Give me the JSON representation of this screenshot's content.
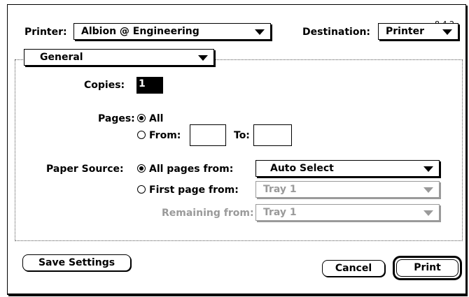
{
  "version": "8.4.2",
  "printer": {
    "label": "Printer:",
    "value": "Albion @ Engineering"
  },
  "destination": {
    "label": "Destination:",
    "value": "Printer"
  },
  "section": {
    "value": "General"
  },
  "copies": {
    "label": "Copies:",
    "value": "1"
  },
  "pages": {
    "label": "Pages:",
    "all_label": "All",
    "from_label": "From:",
    "to_label": "To:",
    "from_value": "",
    "to_value": "",
    "selected": "all"
  },
  "paper_source": {
    "label": "Paper Source:",
    "all_pages_label": "All pages from:",
    "all_pages_value": "Auto Select",
    "first_page_label": "First page from:",
    "first_page_value": "Tray 1",
    "remaining_label": "Remaining from:",
    "remaining_value": "Tray 1",
    "selected": "all_pages"
  },
  "buttons": {
    "save_settings": "Save Settings",
    "cancel": "Cancel",
    "print": "Print"
  }
}
